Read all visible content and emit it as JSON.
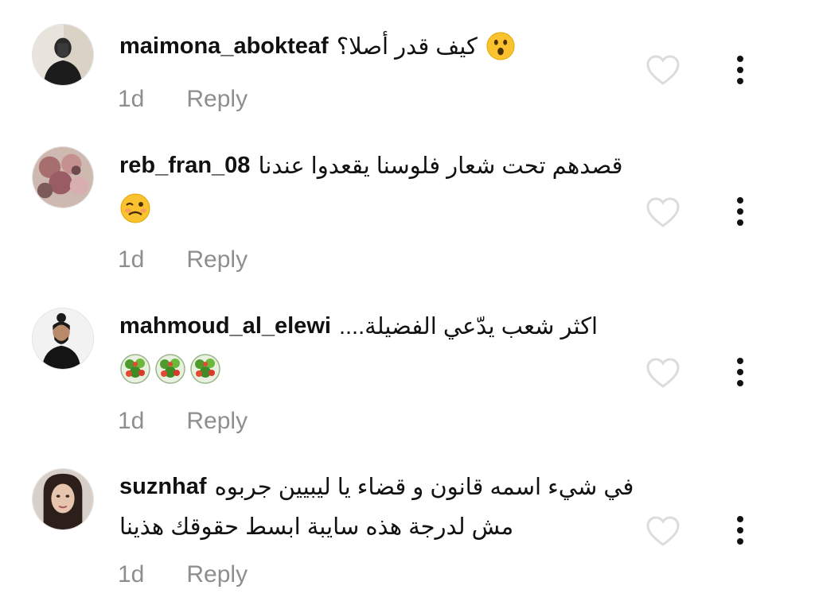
{
  "comments": [
    {
      "username": "maimona_abokteaf",
      "text": "كيف قدر أصلا؟",
      "emoji": "astonished-face",
      "time": "1d",
      "reply_label": "Reply"
    },
    {
      "username": "reb_fran_08",
      "text": "قصدهم تحت شعار فلوسنا يقعدوا عندنا",
      "emoji": "woozy-face",
      "time": "1d",
      "reply_label": "Reply"
    },
    {
      "username": "mahmoud_al_elewi",
      "text": "اكثر شعب يدّعي الفضيلة....",
      "emoji": "salad",
      "time": "1d",
      "reply_label": "Reply"
    },
    {
      "username": "suznhaf",
      "text": "في شيء اسمه قانون و قضاء يا ليبيين جربوه",
      "text_line2": "مش لدرجة هذه سايبة ابسط حقوقك هذينا",
      "time": "1d",
      "reply_label": "Reply"
    }
  ],
  "colors": {
    "meta": "#8e8e8e",
    "heart_outline": "#dcdcdc",
    "more_dots": "#111111"
  },
  "icons": [
    "heart-outline-icon",
    "more-vertical-icon"
  ]
}
